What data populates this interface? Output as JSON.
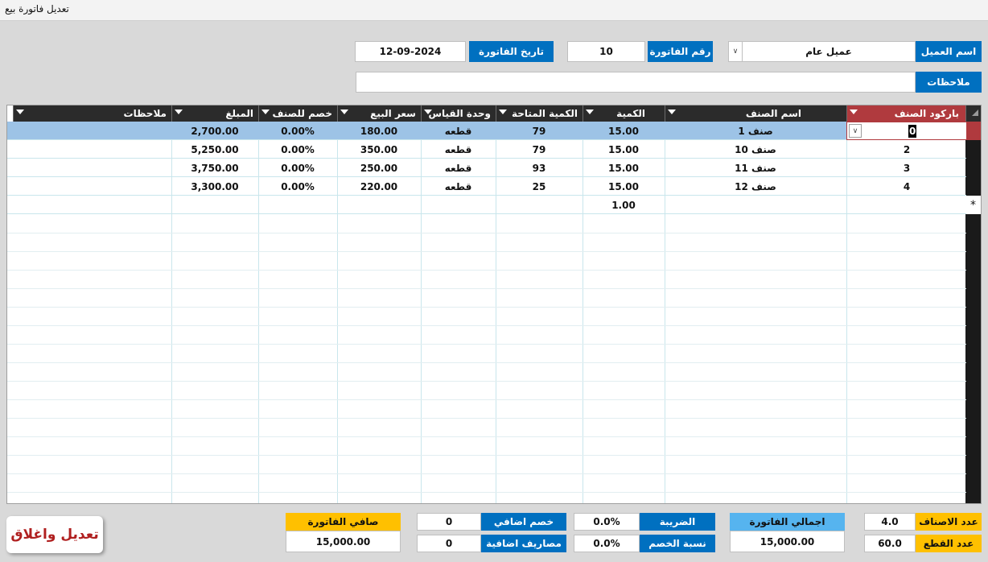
{
  "window": {
    "title": "تعديل فاتورة بيع"
  },
  "header": {
    "customer_label": "اسم العميل",
    "customer_value": "عميل عام",
    "invoice_no_label": "رقم الفاتورة",
    "invoice_no_value": "10",
    "invoice_date_label": "تاريخ الفاتورة",
    "invoice_date_value": "12-09-2024",
    "notes_label": "ملاحظات",
    "notes_value": ""
  },
  "grid": {
    "columns": {
      "barcode": "باركود الصنف",
      "item_name": "اسم الصنف",
      "qty": "الكمية",
      "available_qty": "الكمية المتاحة",
      "unit": "وحدة القياس",
      "sale_price": "سعر البيع",
      "item_discount": "خصم للصنف",
      "amount": "المبلغ",
      "notes": "ملاحظات"
    },
    "rows": [
      {
        "barcode": "0",
        "item_name": "صنف 1",
        "qty": "15.00",
        "available_qty": "79",
        "unit": "قطعه",
        "sale_price": "180.00",
        "item_discount": "0.00%",
        "amount": "2,700.00",
        "notes": ""
      },
      {
        "barcode": "2",
        "item_name": "صنف 10",
        "qty": "15.00",
        "available_qty": "79",
        "unit": "قطعه",
        "sale_price": "350.00",
        "item_discount": "0.00%",
        "amount": "5,250.00",
        "notes": ""
      },
      {
        "barcode": "3",
        "item_name": "صنف 11",
        "qty": "15.00",
        "available_qty": "93",
        "unit": "قطعه",
        "sale_price": "250.00",
        "item_discount": "0.00%",
        "amount": "3,750.00",
        "notes": ""
      },
      {
        "barcode": "4",
        "item_name": "صنف 12",
        "qty": "15.00",
        "available_qty": "25",
        "unit": "قطعه",
        "sale_price": "220.00",
        "item_discount": "0.00%",
        "amount": "3,300.00",
        "notes": ""
      }
    ],
    "new_row": {
      "qty": "1.00",
      "marker": "*"
    }
  },
  "footer": {
    "save_close_button": "تعديل واغلاق",
    "items_count_label": "عدد الاصناف",
    "items_count_value": "4.0",
    "pieces_count_label": "عدد القطع",
    "pieces_count_value": "60.0",
    "invoice_total_label": "اجمالي الفاتورة",
    "invoice_total_value": "15,000.00",
    "tax_label": "الضريبة",
    "tax_value": "0.0%",
    "discount_rate_label": "نسبة الخصم",
    "discount_rate_value": "0.0%",
    "extra_discount_label": "خصم اضافي",
    "extra_discount_value": "0",
    "extra_expenses_label": "مصاريف اضافية",
    "extra_expenses_value": "0",
    "net_total_label": "صافي الفاتورة",
    "net_total_value": "15,000.00"
  },
  "colors": {
    "label_blue": "#0070c0",
    "header_dark": "#2b2b2b",
    "barcode_header": "#b03a3e",
    "selected_row": "#9dc3e6",
    "net_total_label": "#ffc000",
    "invoice_total_label": "#56b4ef",
    "save_button_text": "#b02020"
  }
}
